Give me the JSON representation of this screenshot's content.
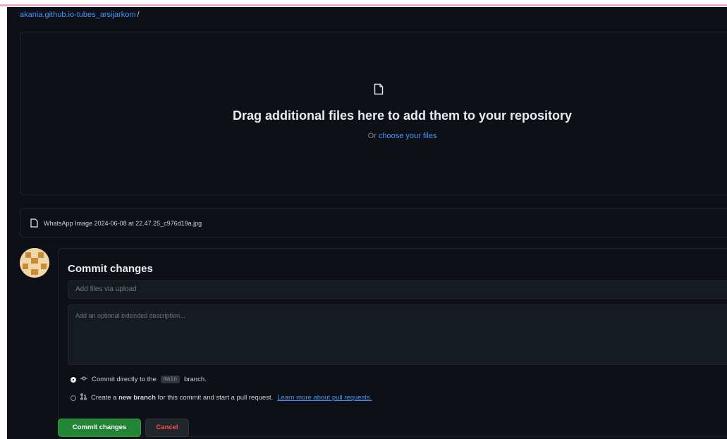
{
  "breadcrumb": {
    "repo": "akania.github.io-tubes_arsijarkom",
    "separator": "/"
  },
  "dropzone": {
    "icon": "file-icon",
    "headline": "Drag additional files here to add them to your repository",
    "or_text": "Or",
    "choose_link": "choose your files"
  },
  "uploaded_files": [
    {
      "icon": "file-icon",
      "name": "WhatsApp Image 2024-06-08 at 22.47.25_c976d19a.jpg"
    }
  ],
  "commit": {
    "title": "Commit changes",
    "summary_placeholder": "Add files via upload",
    "description_placeholder": "Add an optional extended description...",
    "option_direct": {
      "prefix": "Commit directly to the",
      "branch": "main",
      "suffix": "branch.",
      "selected": true
    },
    "option_new_branch": {
      "text_a": "Create a",
      "text_bold": "new branch",
      "text_b": "for this commit and start a pull request.",
      "link": "Learn more about pull requests.",
      "selected": false
    },
    "commit_button": "Commit changes",
    "cancel_button": "Cancel"
  },
  "colors": {
    "background": "#0d1117",
    "link": "#4493f8",
    "primary_button": "#238636",
    "danger_text": "#f85149"
  }
}
